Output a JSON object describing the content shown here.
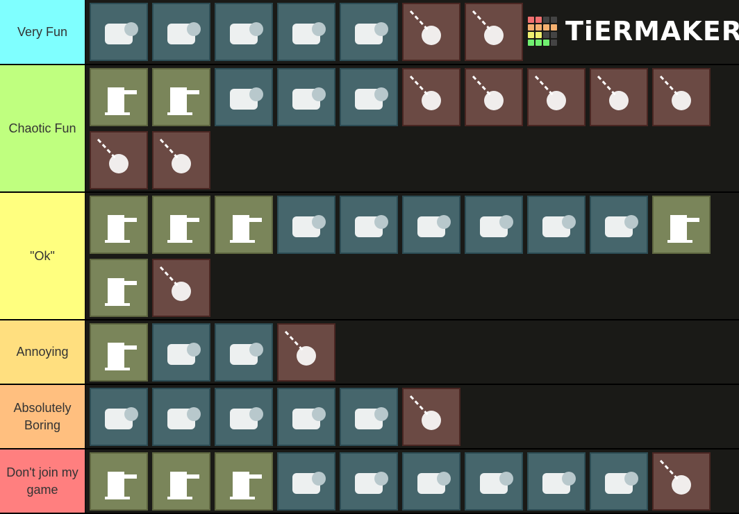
{
  "app": "TierMaker",
  "logo": {
    "text": "TiERMAKER",
    "grid_colors": [
      "#f07070",
      "#f07070",
      "#444444",
      "#444444",
      "#f5b070",
      "#f5b070",
      "#f5b070",
      "#f5b070",
      "#f0f070",
      "#f0f070",
      "#444444",
      "#444444",
      "#70f070",
      "#70f070",
      "#70f070",
      "#444444"
    ]
  },
  "tile_colors": {
    "blue": "#46666c",
    "green": "#7a855a",
    "red": "#6b4a44"
  },
  "tiers": [
    {
      "label": "Very Fun",
      "color": "#7fffff",
      "items": [
        {
          "icon": "flamethrower-icon",
          "cat": "blue"
        },
        {
          "icon": "heavy-machine-gun-icon",
          "cat": "blue"
        },
        {
          "icon": "shield-generator-icon",
          "cat": "blue"
        },
        {
          "icon": "mech-exosuit-icon",
          "cat": "blue"
        },
        {
          "icon": "rocket-pod-launcher-icon",
          "cat": "blue"
        },
        {
          "icon": "airdrop-cluster-icon",
          "cat": "red"
        },
        {
          "icon": "orbital-strike-icon",
          "cat": "red"
        }
      ]
    },
    {
      "label": "Chaotic Fun",
      "color": "#bfff7f",
      "items": [
        {
          "icon": "mortar-sentry-icon",
          "cat": "green"
        },
        {
          "icon": "barbed-wire-icon",
          "cat": "green"
        },
        {
          "icon": "grenade-launcher-icon",
          "cat": "blue"
        },
        {
          "icon": "recoilless-rifle-icon",
          "cat": "blue"
        },
        {
          "icon": "supply-ammo-icon",
          "cat": "blue"
        },
        {
          "icon": "triple-strike-icon",
          "cat": "red"
        },
        {
          "icon": "missile-icon",
          "cat": "red"
        },
        {
          "icon": "laser-strike-icon",
          "cat": "red"
        },
        {
          "icon": "gatling-strike-icon",
          "cat": "red"
        },
        {
          "icon": "rocket-barrage-icon",
          "cat": "red"
        },
        {
          "icon": "ring-target-icon",
          "cat": "red"
        },
        {
          "icon": "walking-barrage-icon",
          "cat": "red"
        }
      ]
    },
    {
      "label": "\"Ok\"",
      "color": "#ffff7f",
      "items": [
        {
          "icon": "gatling-sentry-icon",
          "cat": "green"
        },
        {
          "icon": "autocannon-sentry-icon",
          "cat": "green"
        },
        {
          "icon": "smoke-beacon-icon",
          "cat": "green"
        },
        {
          "icon": "heart-gear-icon",
          "cat": "blue"
        },
        {
          "icon": "stim-pack-icon",
          "cat": "blue"
        },
        {
          "icon": "jetpack-wings-icon",
          "cat": "blue"
        },
        {
          "icon": "drone-backpack-icon",
          "cat": "blue"
        },
        {
          "icon": "railgun-icon",
          "cat": "blue"
        },
        {
          "icon": "supply-pack-icon",
          "cat": "blue"
        },
        {
          "icon": "tesla-tower-icon",
          "cat": "green"
        },
        {
          "icon": "mine-field-stars-icon",
          "cat": "green"
        },
        {
          "icon": "precision-strike-icon",
          "cat": "red"
        }
      ]
    },
    {
      "label": "Annoying",
      "color": "#ffdf7f",
      "items": [
        {
          "icon": "anti-personnel-mines-icon",
          "cat": "green"
        },
        {
          "icon": "bubble-shield-icon",
          "cat": "blue"
        },
        {
          "icon": "spear-launcher-icon",
          "cat": "blue"
        },
        {
          "icon": "napalm-fire-icon",
          "cat": "red"
        }
      ]
    },
    {
      "label": "Absolutely Boring",
      "color": "#ffbf7f",
      "items": [
        {
          "icon": "ballistic-shield-icon",
          "cat": "blue"
        },
        {
          "icon": "arc-thrower-icon",
          "cat": "blue"
        },
        {
          "icon": "patriot-mech-icon",
          "cat": "blue"
        },
        {
          "icon": "reinforce-arc-icon",
          "cat": "blue"
        },
        {
          "icon": "airburst-launcher-icon",
          "cat": "blue"
        },
        {
          "icon": "barrage-ring-icon",
          "cat": "red"
        }
      ]
    },
    {
      "label": "Don't join my game",
      "color": "#ff7f7f",
      "items": [
        {
          "icon": "rocket-sentry-icon",
          "cat": "green"
        },
        {
          "icon": "tesla-emitter-icon",
          "cat": "green"
        },
        {
          "icon": "radar-station-icon",
          "cat": "green"
        },
        {
          "icon": "emancipator-mech-icon",
          "cat": "blue"
        },
        {
          "icon": "mortar-tube-icon",
          "cat": "blue"
        },
        {
          "icon": "armored-vehicle-icon",
          "cat": "blue"
        },
        {
          "icon": "tank-vehicle-icon",
          "cat": "blue"
        },
        {
          "icon": "shredder-icon",
          "cat": "blue"
        },
        {
          "icon": "hellpod-hose-icon",
          "cat": "blue"
        },
        {
          "icon": "cooldown-reduction-icon",
          "cat": "red"
        }
      ]
    }
  ]
}
